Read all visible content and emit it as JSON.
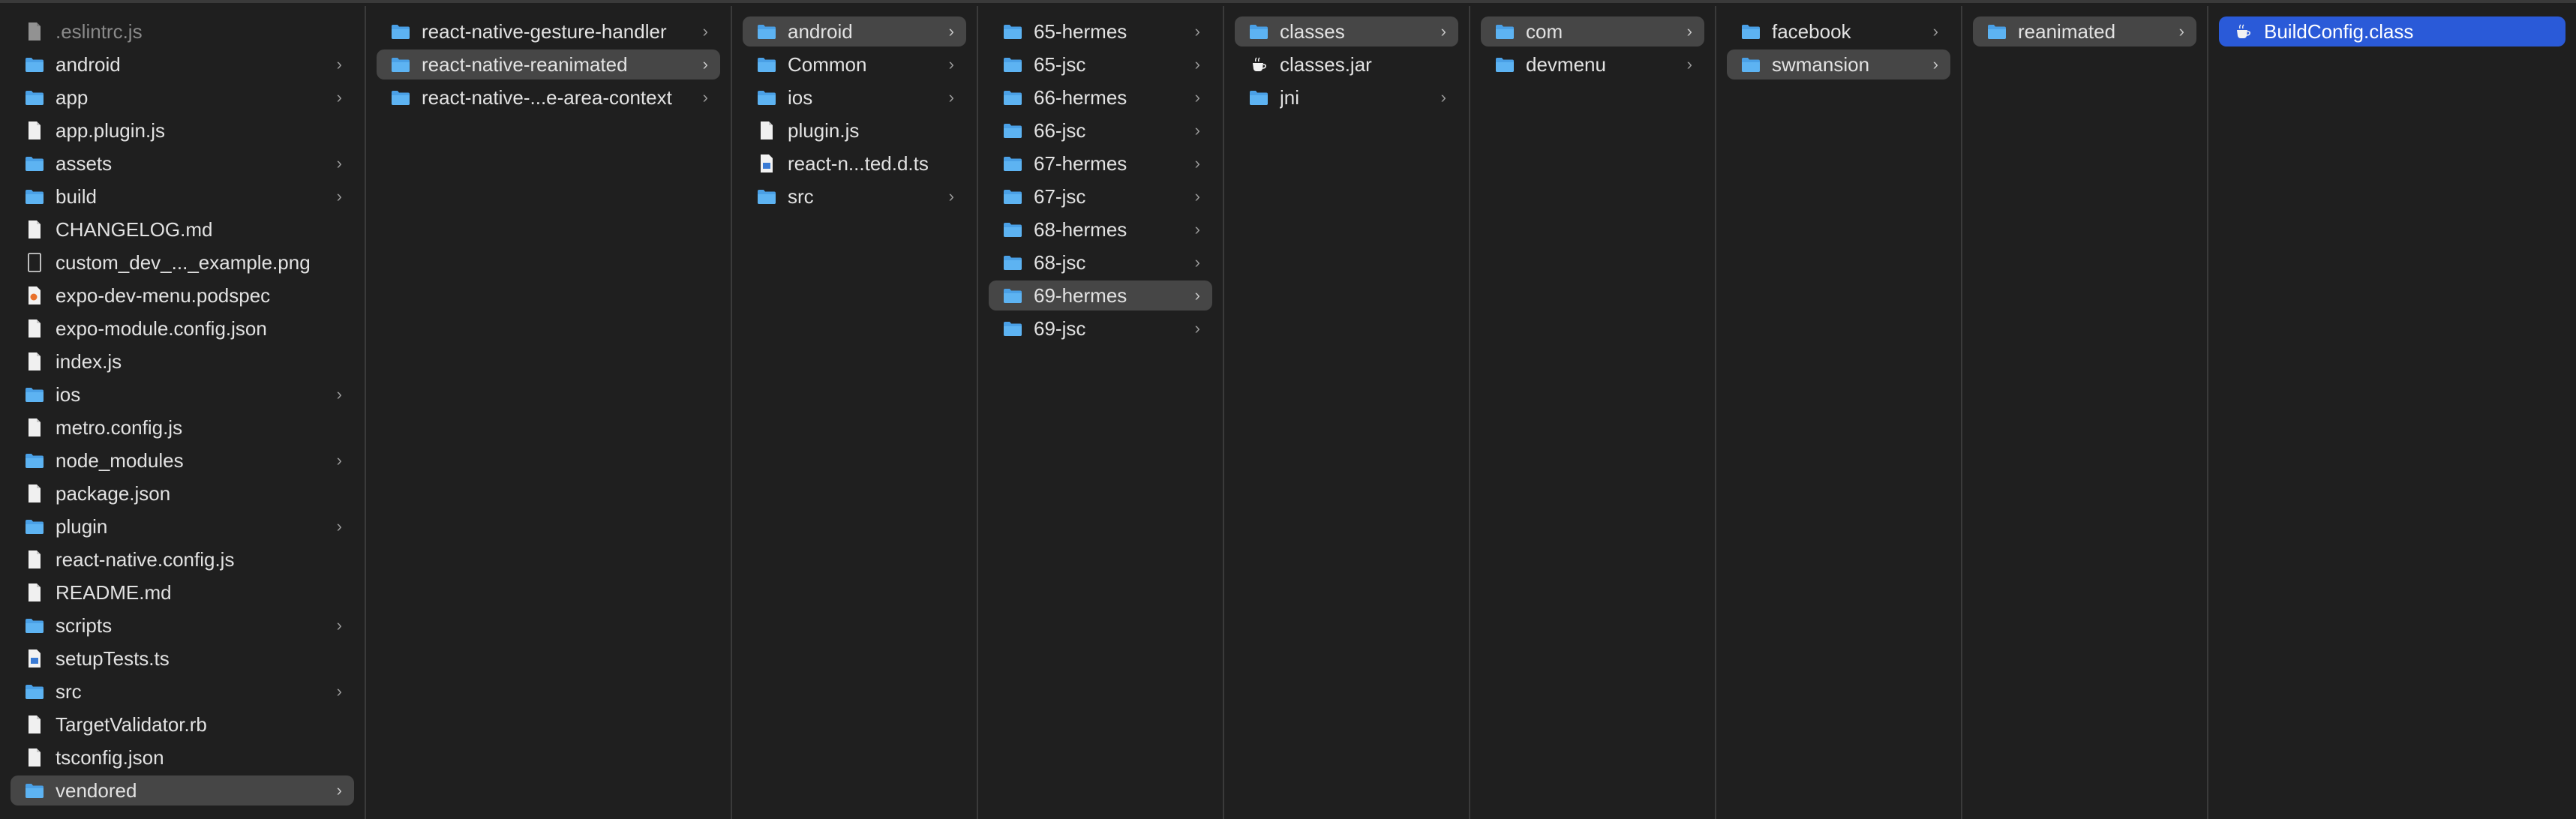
{
  "colors": {
    "background": "#1f1f1f",
    "divider": "#3a3a3a",
    "selection_gray": "#464646",
    "selection_blue": "#2a5ad8",
    "folder": "#4aa0e6"
  },
  "columns": [
    {
      "name": "column-expo-dev-menu",
      "items": [
        {
          "label": ".eslintrc.js",
          "type": "file",
          "dim": true
        },
        {
          "label": "android",
          "type": "folder",
          "chevron": true
        },
        {
          "label": "app",
          "type": "folder",
          "chevron": true
        },
        {
          "label": "app.plugin.js",
          "type": "file"
        },
        {
          "label": "assets",
          "type": "folder",
          "chevron": true
        },
        {
          "label": "build",
          "type": "folder",
          "chevron": true
        },
        {
          "label": "CHANGELOG.md",
          "type": "file"
        },
        {
          "label": "custom_dev_..._example.png",
          "type": "image"
        },
        {
          "label": "expo-dev-menu.podspec",
          "type": "podspec"
        },
        {
          "label": "expo-module.config.json",
          "type": "file"
        },
        {
          "label": "index.js",
          "type": "file"
        },
        {
          "label": "ios",
          "type": "folder",
          "chevron": true
        },
        {
          "label": "metro.config.js",
          "type": "file"
        },
        {
          "label": "node_modules",
          "type": "folder",
          "chevron": true
        },
        {
          "label": "package.json",
          "type": "file"
        },
        {
          "label": "plugin",
          "type": "folder",
          "chevron": true
        },
        {
          "label": "react-native.config.js",
          "type": "file"
        },
        {
          "label": "README.md",
          "type": "file"
        },
        {
          "label": "scripts",
          "type": "folder",
          "chevron": true
        },
        {
          "label": "setupTests.ts",
          "type": "ts"
        },
        {
          "label": "src",
          "type": "folder",
          "chevron": true
        },
        {
          "label": "TargetValidator.rb",
          "type": "file"
        },
        {
          "label": "tsconfig.json",
          "type": "file"
        },
        {
          "label": "vendored",
          "type": "folder",
          "chevron": true,
          "selected": "gray"
        }
      ]
    },
    {
      "name": "column-vendored",
      "items": [
        {
          "label": "react-native-gesture-handler",
          "type": "folder",
          "chevron": true
        },
        {
          "label": "react-native-reanimated",
          "type": "folder",
          "chevron": true,
          "selected": "gray"
        },
        {
          "label": "react-native-...e-area-context",
          "type": "folder",
          "chevron": true
        }
      ]
    },
    {
      "name": "column-react-native-reanimated",
      "items": [
        {
          "label": "android",
          "type": "folder",
          "chevron": true,
          "selected": "gray"
        },
        {
          "label": "Common",
          "type": "folder",
          "chevron": true
        },
        {
          "label": "ios",
          "type": "folder",
          "chevron": true
        },
        {
          "label": "plugin.js",
          "type": "file"
        },
        {
          "label": "react-n...ted.d.ts",
          "type": "ts"
        },
        {
          "label": "src",
          "type": "folder",
          "chevron": true
        }
      ]
    },
    {
      "name": "column-android",
      "items": [
        {
          "label": "65-hermes",
          "type": "folder",
          "chevron": true
        },
        {
          "label": "65-jsc",
          "type": "folder",
          "chevron": true
        },
        {
          "label": "66-hermes",
          "type": "folder",
          "chevron": true
        },
        {
          "label": "66-jsc",
          "type": "folder",
          "chevron": true
        },
        {
          "label": "67-hermes",
          "type": "folder",
          "chevron": true
        },
        {
          "label": "67-jsc",
          "type": "folder",
          "chevron": true
        },
        {
          "label": "68-hermes",
          "type": "folder",
          "chevron": true
        },
        {
          "label": "68-jsc",
          "type": "folder",
          "chevron": true
        },
        {
          "label": "69-hermes",
          "type": "folder",
          "chevron": true,
          "selected": "gray"
        },
        {
          "label": "69-jsc",
          "type": "folder",
          "chevron": true
        }
      ]
    },
    {
      "name": "column-69-hermes",
      "items": [
        {
          "label": "classes",
          "type": "folder",
          "chevron": true,
          "selected": "gray"
        },
        {
          "label": "classes.jar",
          "type": "java"
        },
        {
          "label": "jni",
          "type": "folder",
          "chevron": true
        }
      ]
    },
    {
      "name": "column-classes",
      "items": [
        {
          "label": "com",
          "type": "folder",
          "chevron": true,
          "selected": "gray"
        },
        {
          "label": "devmenu",
          "type": "folder",
          "chevron": true
        }
      ]
    },
    {
      "name": "column-com",
      "items": [
        {
          "label": "facebook",
          "type": "folder",
          "chevron": true
        },
        {
          "label": "swmansion",
          "type": "folder",
          "chevron": true,
          "selected": "gray"
        }
      ]
    },
    {
      "name": "column-swmansion",
      "items": [
        {
          "label": "reanimated",
          "type": "folder",
          "chevron": true,
          "selected": "gray"
        }
      ]
    },
    {
      "name": "column-reanimated",
      "items": [
        {
          "label": "BuildConfig.class",
          "type": "java",
          "selected": "blue"
        }
      ]
    }
  ]
}
